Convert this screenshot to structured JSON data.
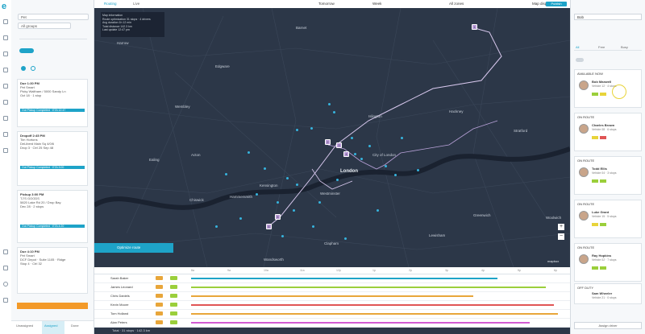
{
  "app": {
    "logo_letter": "e"
  },
  "left_panel": {
    "search_value": "Pet",
    "filter_placeholder": "All groups",
    "cards": [
      {
        "title": "Due 1:30 PM",
        "subtitle": "Pet Smart",
        "lines": [
          "Picky Waltham / 5000 Sandy Ln",
          "Oct 18 · 1 stop"
        ],
        "status": "Out Pickup Completed · ETA 12:47"
      },
      {
        "title": "Dropoff 2:45 PM",
        "subtitle": "Tim Hortons",
        "lines": [
          "DeLiberd Main Sq 4/0/6",
          "Drop 3 · Ctrl 25 Sep 48"
        ],
        "status": "Out Pickup Completed · ETA 3:00"
      },
      {
        "title": "Pickup 3:00 PM",
        "subtitle": "TJ'S GOODS",
        "lines": [
          "5820 Lake Rd 20 / Drop Bay",
          "Dec 28 · 2 stops"
        ],
        "status": "Out Pickup Completed · ETA 4:20"
      },
      {
        "title": "Due 4:10 PM",
        "subtitle": "Pet Smart",
        "lines": [
          "DCF Depot · Suite 1105 · Ridge",
          "Stop 4 · Ctrl 32"
        ],
        "status": ""
      }
    ],
    "bottom_buttons": [
      "Unassigned",
      "Assigned",
      "Done"
    ]
  },
  "topbar": {
    "left_tab": "Routing",
    "center_date": "Tomorrow",
    "view_label": "Week",
    "zone_label": "All zones",
    "map_label": "Map display",
    "publish_label": "Publish"
  },
  "map": {
    "tooltip_lines": [
      "Map information",
      "Route optimization 31 stops · 4 drivers",
      "Avg duration 1h 12 min",
      "Total distance 142.3 km",
      "Last update 12:47 pm"
    ],
    "places": [
      {
        "name": "Harrow",
        "bold": false
      },
      {
        "name": "Barnet",
        "bold": false
      },
      {
        "name": "Edgware",
        "bold": false
      },
      {
        "name": "Wembley",
        "bold": false
      },
      {
        "name": "Islington",
        "bold": false
      },
      {
        "name": "Hackney",
        "bold": false
      },
      {
        "name": "Ealing",
        "bold": false
      },
      {
        "name": "Acton",
        "bold": false
      },
      {
        "name": "City of London",
        "bold": false
      },
      {
        "name": "London",
        "bold": true
      },
      {
        "name": "Westminster",
        "bold": false
      },
      {
        "name": "Kensington",
        "bold": false
      },
      {
        "name": "Hammersmith",
        "bold": false
      },
      {
        "name": "Chiswick",
        "bold": false
      },
      {
        "name": "Greenwich",
        "bold": false
      },
      {
        "name": "Lewisham",
        "bold": false
      },
      {
        "name": "Clapham",
        "bold": false
      },
      {
        "name": "Wandsworth",
        "bold": false
      },
      {
        "name": "Stratford",
        "bold": false
      },
      {
        "name": "Woolwich",
        "bold": false
      }
    ],
    "route_button": "Optimize route",
    "attribution": "mapbox"
  },
  "timeline": {
    "hours": [
      "8a",
      "9a",
      "10a",
      "11a",
      "12p",
      "1p",
      "2p",
      "3p",
      "4p",
      "5p",
      "6p"
    ],
    "rows": [
      {
        "name": "Sarah Baker",
        "color": "#1ea3c8"
      },
      {
        "name": "James Leonard",
        "color": "#9bcf3b"
      },
      {
        "name": "Chris Daniels",
        "color": "#e8a63a"
      },
      {
        "name": "Kevin Moore",
        "color": "#e05555"
      },
      {
        "name": "Tom Holland",
        "color": "#e8a63a"
      },
      {
        "name": "Alan Peters",
        "color": "#d35bd3"
      }
    ],
    "footer": "Total · 31 stops · 142.3 km"
  },
  "right_panel": {
    "search_value": "Bob",
    "tabs": [
      "All",
      "Free",
      "Busy"
    ],
    "drivers": [
      {
        "header": "AVAILABLE NOW",
        "name": "Bob Maxwell",
        "sub": "Vehicle 12 · 4 stops"
      },
      {
        "header": "ON ROUTE",
        "name": "Charles Brown",
        "sub": "Vehicle 08 · 6 stops"
      },
      {
        "header": "ON ROUTE",
        "name": "Todd Ellis",
        "sub": "Vehicle 04 · 3 stops"
      },
      {
        "header": "ON ROUTE",
        "name": "Luke Grant",
        "sub": "Vehicle 15 · 5 stops"
      },
      {
        "header": "ON ROUTE",
        "name": "Ray Hopkins",
        "sub": "Vehicle 02 · 7 stops"
      },
      {
        "header": "OFF DUTY",
        "name": "Sam Wheeler",
        "sub": "Vehicle 21 · 0 stops"
      }
    ],
    "bottom_label": "Assign driver"
  }
}
